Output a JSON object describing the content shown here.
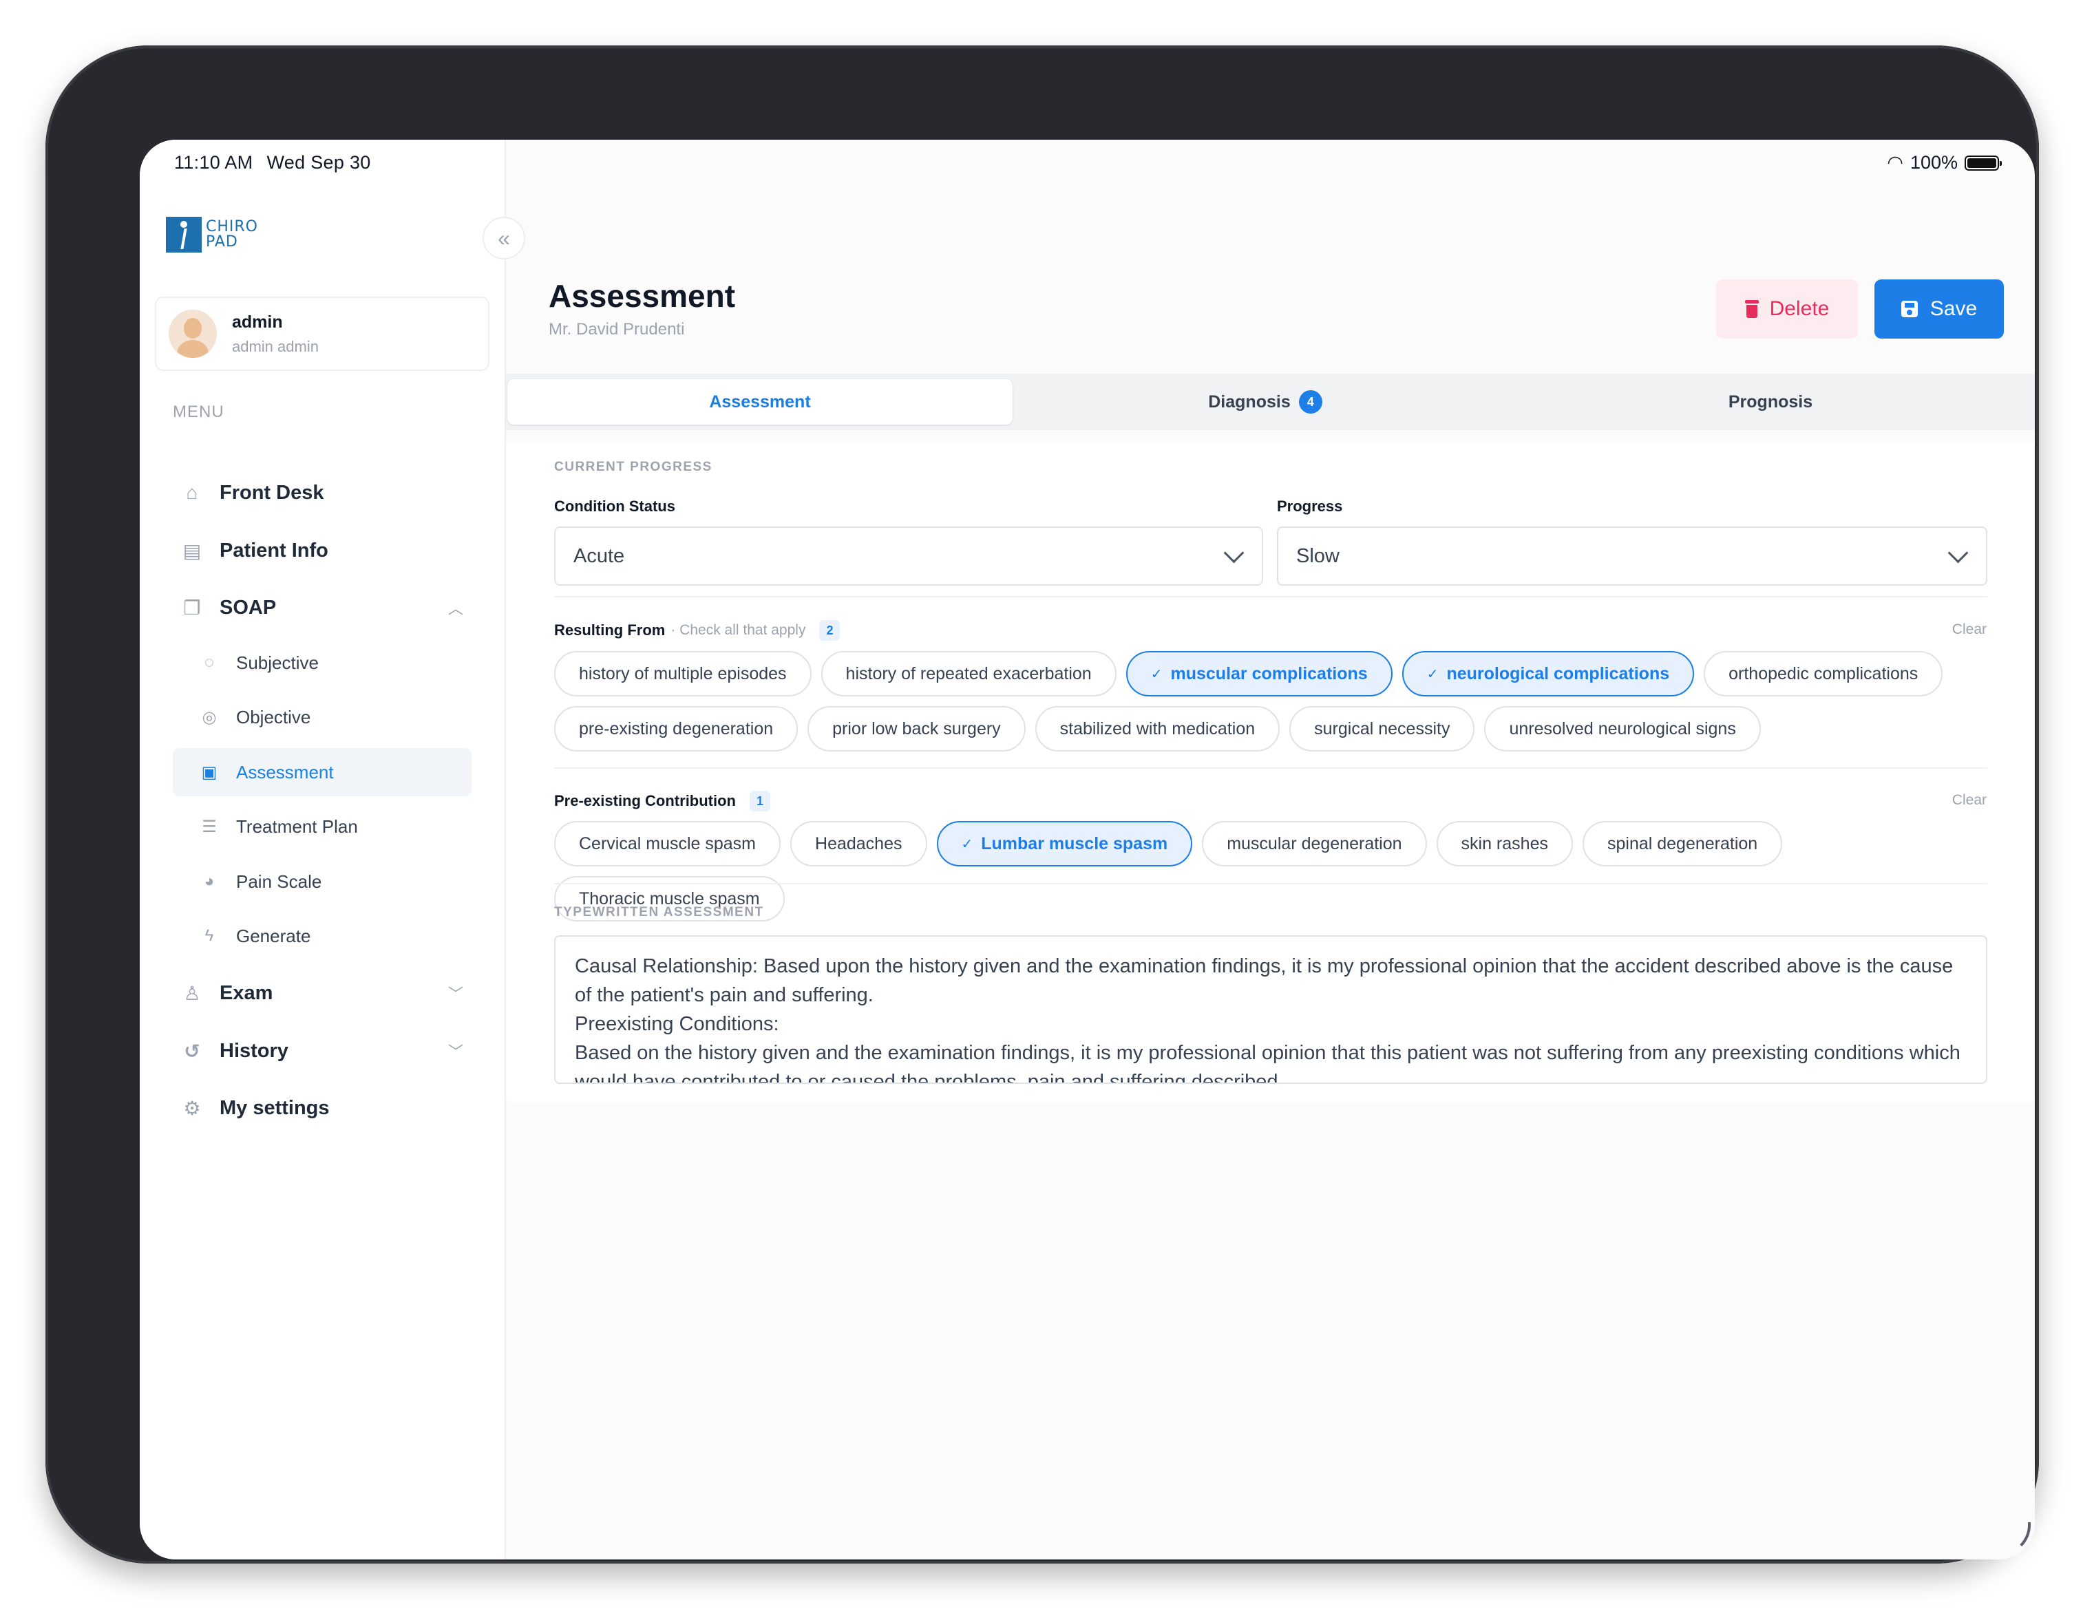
{
  "status_bar": {
    "time": "11:10 AM",
    "date": "Wed Sep 30",
    "battery": "100%"
  },
  "logo": {
    "line1": "CHIRO",
    "line2": "PAD"
  },
  "user": {
    "name": "admin",
    "subtitle": "admin admin"
  },
  "menu_label": "MENU",
  "nav": {
    "front_desk": "Front Desk",
    "patient_info": "Patient Info",
    "soap": "SOAP",
    "soap_items": {
      "subjective": "Subjective",
      "objective": "Objective",
      "assessment": "Assessment",
      "treatment_plan": "Treatment Plan",
      "pain_scale": "Pain Scale",
      "generate": "Generate"
    },
    "exam": "Exam",
    "history": "History",
    "my_settings": "My settings"
  },
  "header": {
    "title": "Assessment",
    "patient": "Mr. David Prudenti",
    "delete_label": "Delete",
    "save_label": "Save"
  },
  "tabs": {
    "assessment": "Assessment",
    "diagnosis": "Diagnosis",
    "diagnosis_count": "4",
    "prognosis": "Prognosis"
  },
  "current_progress": {
    "caption": "CURRENT PROGRESS",
    "condition_label": "Condition Status",
    "condition_value": "Acute",
    "progress_label": "Progress",
    "progress_value": "Slow"
  },
  "resulting_from": {
    "label": "Resulting From",
    "hint": "· Check all that apply",
    "count": "2",
    "clear": "Clear",
    "options": [
      {
        "label": "history of multiple episodes",
        "selected": false
      },
      {
        "label": "history of repeated exacerbation",
        "selected": false
      },
      {
        "label": "muscular complications",
        "selected": true
      },
      {
        "label": "neurological complications",
        "selected": true
      },
      {
        "label": "orthopedic complications",
        "selected": false
      },
      {
        "label": "pre-existing degeneration",
        "selected": false
      },
      {
        "label": "prior low back surgery",
        "selected": false
      },
      {
        "label": "stabilized with medication",
        "selected": false
      },
      {
        "label": "surgical necessity",
        "selected": false
      },
      {
        "label": "unresolved neurological signs",
        "selected": false
      }
    ]
  },
  "preexisting": {
    "label": "Pre-existing Contribution",
    "count": "1",
    "clear": "Clear",
    "options": [
      {
        "label": "Cervical muscle spasm",
        "selected": false
      },
      {
        "label": "Headaches",
        "selected": false
      },
      {
        "label": "Lumbar muscle spasm",
        "selected": true
      },
      {
        "label": "muscular degeneration",
        "selected": false
      },
      {
        "label": "skin rashes",
        "selected": false
      },
      {
        "label": "spinal degeneration",
        "selected": false
      },
      {
        "label": "Thoracic muscle spasm",
        "selected": false
      }
    ]
  },
  "typewritten": {
    "caption": "TYPEWRITTEN ASSESSMENT",
    "line1": "Causal Relationship:   Based upon the history given and the examination findings, it is my professional opinion that the accident described above is the cause of the patient's pain and suffering.",
    "line2": "Preexisting Conditions:",
    "line3": "Based on the history given and the examination findings, it is my professional opinion that this patient was not suffering from any preexisting conditions which would have contributed to or caused the problems, pain and suffering described."
  }
}
